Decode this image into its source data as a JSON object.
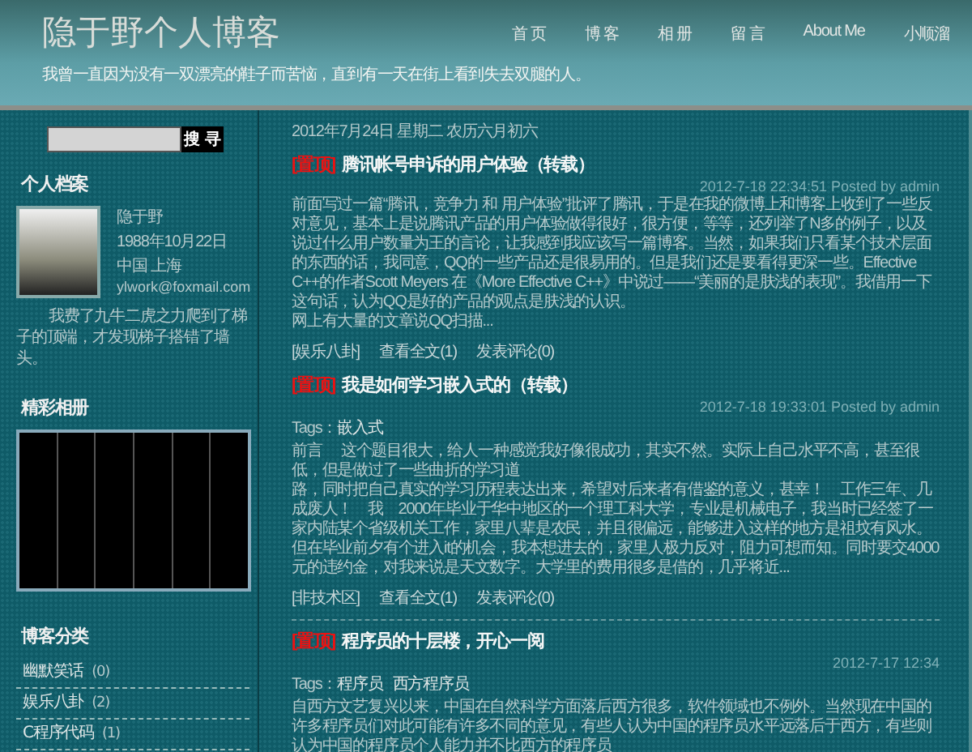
{
  "header": {
    "title": "隐于野个人博客",
    "tagline": "我曾一直因为没有一双漂亮的鞋子而苦恼，直到有一天在街上看到失去双腿的人。"
  },
  "nav": [
    {
      "label": "首 页"
    },
    {
      "label": "博 客"
    },
    {
      "label": "相 册"
    },
    {
      "label": "留 言"
    },
    {
      "label": "About Me"
    },
    {
      "label": "小顺溜"
    }
  ],
  "search": {
    "button": "搜 寻"
  },
  "profile": {
    "heading": "个人档案",
    "name": "隐于野",
    "birthday": "1988年10月22日",
    "location": "中国 上海",
    "email": "ylwork@foxmail.com",
    "motto": "我费了九牛二虎之力爬到了梯子的顶端，才发现梯子搭错了墙头。"
  },
  "album": {
    "heading": "精彩相册"
  },
  "categories": {
    "heading": "博客分类",
    "items": [
      {
        "name": "幽默笑话",
        "count": "(0)"
      },
      {
        "name": "娱乐八卦",
        "count": "(2)"
      },
      {
        "name": "C程序代码",
        "count": "(1)"
      }
    ]
  },
  "date_heading": "2012年7月24日 星期二 农历六月初六",
  "posts": [
    {
      "pinned": "[置顶]",
      "title": "腾讯帐号申诉的用户体验（转载）",
      "meta": "2012-7-18 22:34:51  Posted by admin",
      "body": [
        "前面写过一篇“腾讯，竞争力 和 用户体验”批评了腾讯，于是在我的微博上和博客上收到了一些反对意见，基本上是说腾讯产品的用户体验做得很好，很方便，等等，还列举了N多的例子，以及说过什么用户数量为王的言论，让我感到我应该写一篇博客。当然，如果我们只看某个技术层面的东西的话，我同意，QQ的一些产品还是很易用的。但是我们还是要看得更深一些。Effective C++的作者Scott Meyers 在《More Effective C++》中说过——“美丽的是肤浅的表现”。我借用一下这句话，认为QQ是好的产品的观点是肤浅的认识。",
        "网上有大量的文章说QQ扫描..."
      ],
      "category": "[娱乐八卦]",
      "read_more": "查看全文(1)",
      "comments": "发表评论(0)"
    },
    {
      "pinned": "[置顶]",
      "title": "我是如何学习嵌入式的（转载）",
      "meta": "2012-7-18 19:33:01  Posted by admin",
      "tags_label": "Tags：",
      "tags": [
        "嵌入式"
      ],
      "body": [
        "前言　 这个题目很大，给人一种感觉我好像很成功，其实不然。实际上自己水平不高，甚至很低，但是做过了一些曲折的学习道",
        "路，同时把自己真实的学习历程表达出来，希望对后来者有借鉴的意义，甚幸！　工作三年、几成废人！　我　2000年毕业于华中地区的一个理工科大学，专业是机械电子，我当时已经签了一家内陆某个省级机关工作，家里八辈是农民，并且很偏远，能够进入这样的地方是祖坟有风水。但在毕业前夕有个进入it的机会，我本想进去的，家里人极力反对，阻力可想而知。同时要交4000元的违约金，对我来说是天文数字。大学里的费用很多是借的，几乎将近..."
      ],
      "category": "[非技术区]",
      "read_more": "查看全文(1)",
      "comments": "发表评论(0)"
    },
    {
      "pinned": "[置顶]",
      "title": "程序员的十层楼，开心一阅",
      "meta": "2012-7-17 12:34",
      "tags_label": "Tags：",
      "tags": [
        "程序员",
        "西方程序员"
      ],
      "body": [
        "自西方文艺复兴以来，中国在自然科学方面落后西方很多，软件领域也不例外。当然现在中国的许多程序员们对此可能有许多不同的意见，有些人认为中国的程序员水平远落后于西方，有些则认为中国的程序员个人能力并不比西方的程序员"
      ]
    }
  ]
}
